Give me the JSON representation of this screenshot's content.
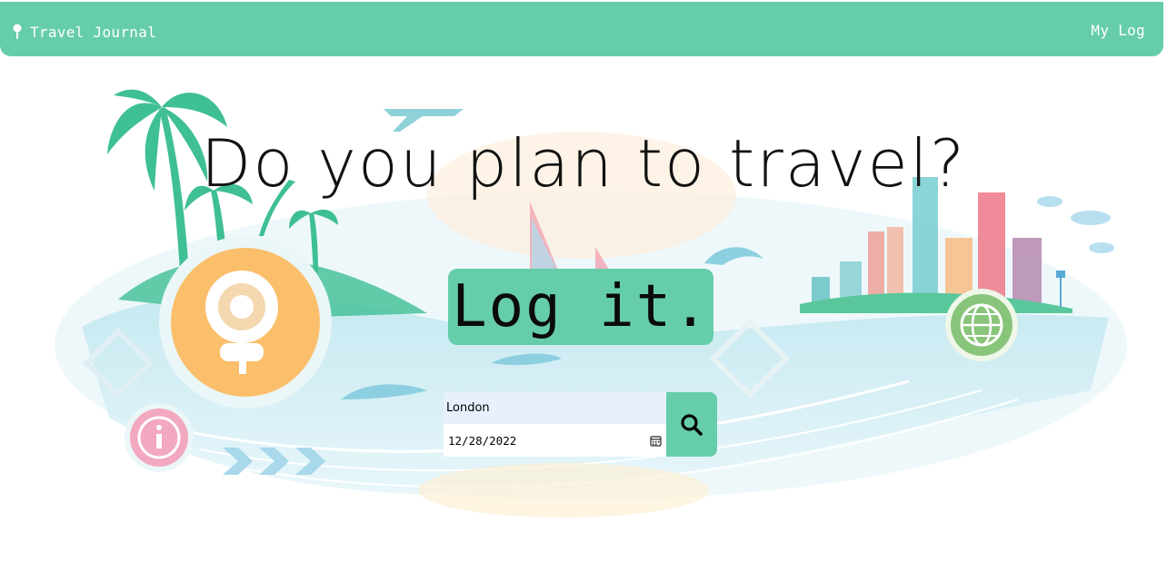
{
  "nav": {
    "brand": "Travel Journal",
    "brand_icon": "pin-icon",
    "mylog": "My Log",
    "color": "#66cdaa"
  },
  "hero": {
    "title": "Do you plan to travel?",
    "cta": "Log it."
  },
  "form": {
    "city_value": "London",
    "date_value": "12/28/2022",
    "search_icon": "search-icon",
    "calendar_icon": "calendar-icon"
  },
  "colors": {
    "accent": "#66cdaa",
    "autofill": "#e8f0fe"
  }
}
